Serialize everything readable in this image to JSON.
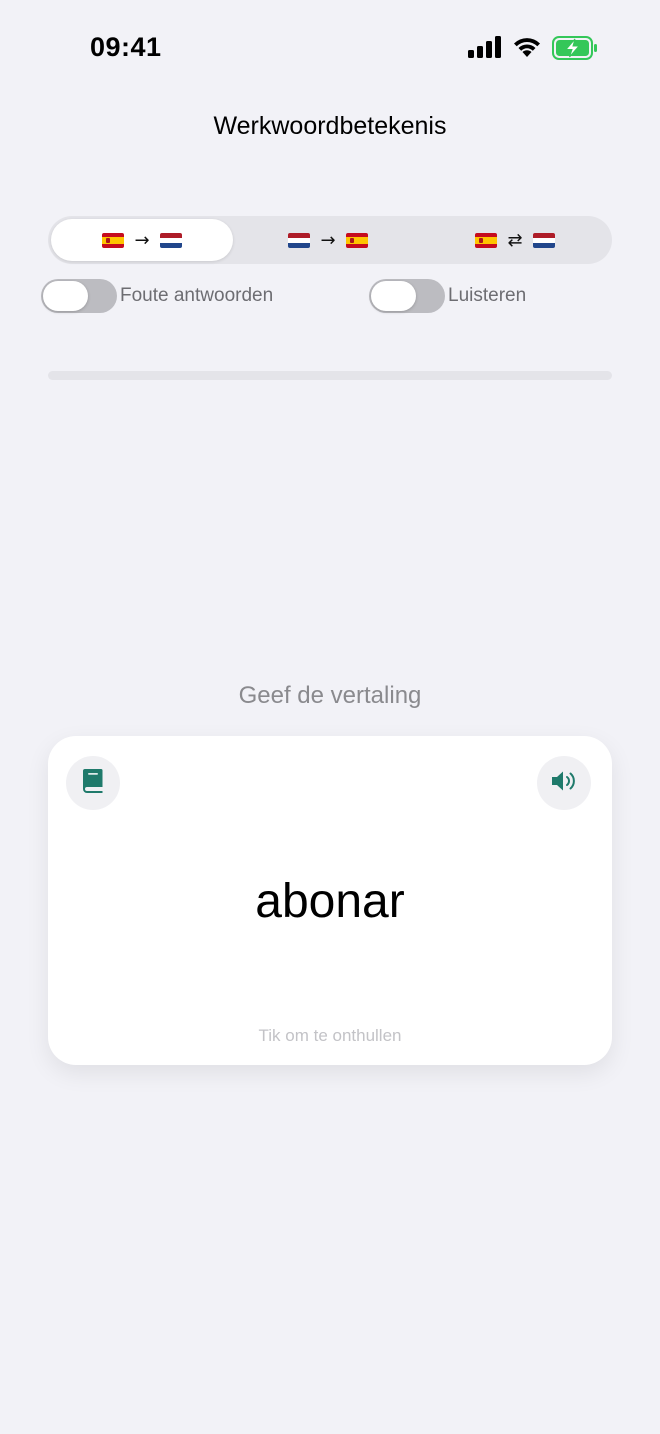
{
  "status_bar": {
    "time": "09:41",
    "icons": [
      "cellular-signal-icon",
      "wifi-icon",
      "battery-charging-icon"
    ]
  },
  "nav": {
    "title": "Werkwoordbetekenis"
  },
  "direction_selector": {
    "selected_index": 0,
    "options": [
      {
        "from": "es-flag-icon",
        "arrow": "→",
        "to": "nl-flag-icon"
      },
      {
        "from": "nl-flag-icon",
        "arrow": "→",
        "to": "es-flag-icon"
      },
      {
        "from": "es-flag-icon",
        "arrow": "⇄",
        "to": "nl-flag-icon"
      }
    ]
  },
  "toggles": {
    "wrong_answers": {
      "label": "Foute antwoorden",
      "on": false
    },
    "listening": {
      "label": "Luisteren",
      "on": false
    }
  },
  "progress": {
    "fraction": 0
  },
  "prompt": "Geef de vertaling",
  "card": {
    "word": "abonar",
    "hint": "Tik om te onthullen",
    "left_icon": "book-icon",
    "right_icon": "speaker-icon"
  },
  "colors": {
    "accent": "#1f7a6b",
    "background": "#f2f2f7",
    "battery": "#34c759"
  }
}
